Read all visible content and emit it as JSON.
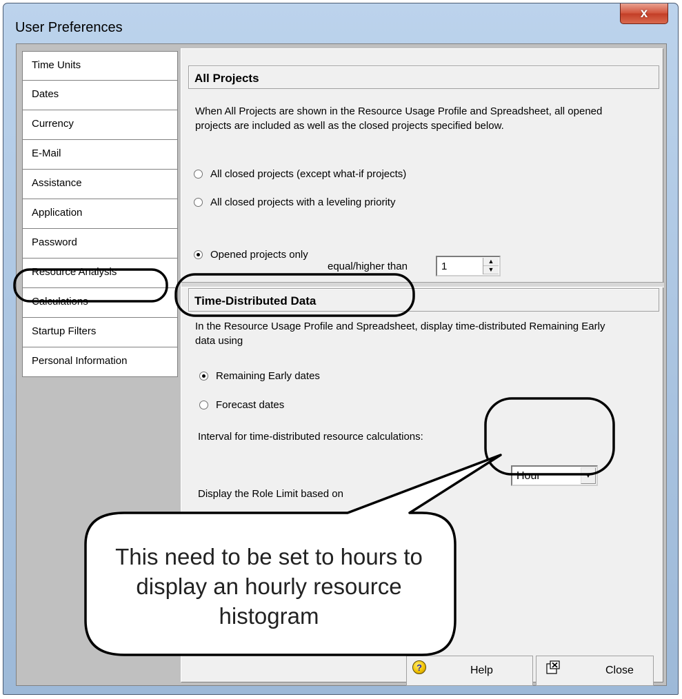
{
  "window": {
    "title": "User Preferences",
    "close_glyph": "x"
  },
  "sidebar": {
    "items": [
      {
        "label": "Time Units"
      },
      {
        "label": "Dates"
      },
      {
        "label": "Currency"
      },
      {
        "label": "E-Mail"
      },
      {
        "label": "Assistance"
      },
      {
        "label": "Application"
      },
      {
        "label": "Password"
      },
      {
        "label": "Resource Analysis",
        "selected": true
      },
      {
        "label": "Calculations"
      },
      {
        "label": "Startup Filters"
      },
      {
        "label": "Personal Information"
      }
    ]
  },
  "all_projects": {
    "header": "All Projects",
    "description": "When All Projects are shown in the Resource Usage Profile and Spreadsheet, all opened projects are included as well as the closed projects specified below.",
    "options": [
      {
        "label": "All closed projects (except what-if projects)",
        "checked": false
      },
      {
        "label": "All closed projects with a leveling priority",
        "checked": false
      },
      {
        "label": "Opened projects only",
        "checked": true
      }
    ],
    "priority_label": "equal/higher than",
    "priority_value": "1"
  },
  "time_distributed": {
    "header": "Time-Distributed Data",
    "description": "In the Resource Usage Profile and Spreadsheet, display time-distributed Remaining Early data using",
    "options": [
      {
        "label": "Remaining Early dates",
        "checked": true
      },
      {
        "label": "Forecast dates",
        "checked": false
      }
    ],
    "interval_label": "Interval for time-distributed resource calculations:",
    "interval_value": "Hour",
    "role_limit_label": "Display the Role Limit based on"
  },
  "callout": {
    "text": "This need to be set to hours to display an hourly resource histogram"
  },
  "footer": {
    "help_label": "Help",
    "close_label": "Close",
    "help_icon_glyph": "?"
  },
  "colors": {
    "annotation_stroke": "#000000",
    "title_gradient": "#bcd3ec",
    "close_button": "#c33e27"
  },
  "icons": [
    "help-icon",
    "close-window-icon",
    "close-x-icon",
    "spin-up-icon",
    "spin-down-icon",
    "dropdown-arrow-icon"
  ]
}
